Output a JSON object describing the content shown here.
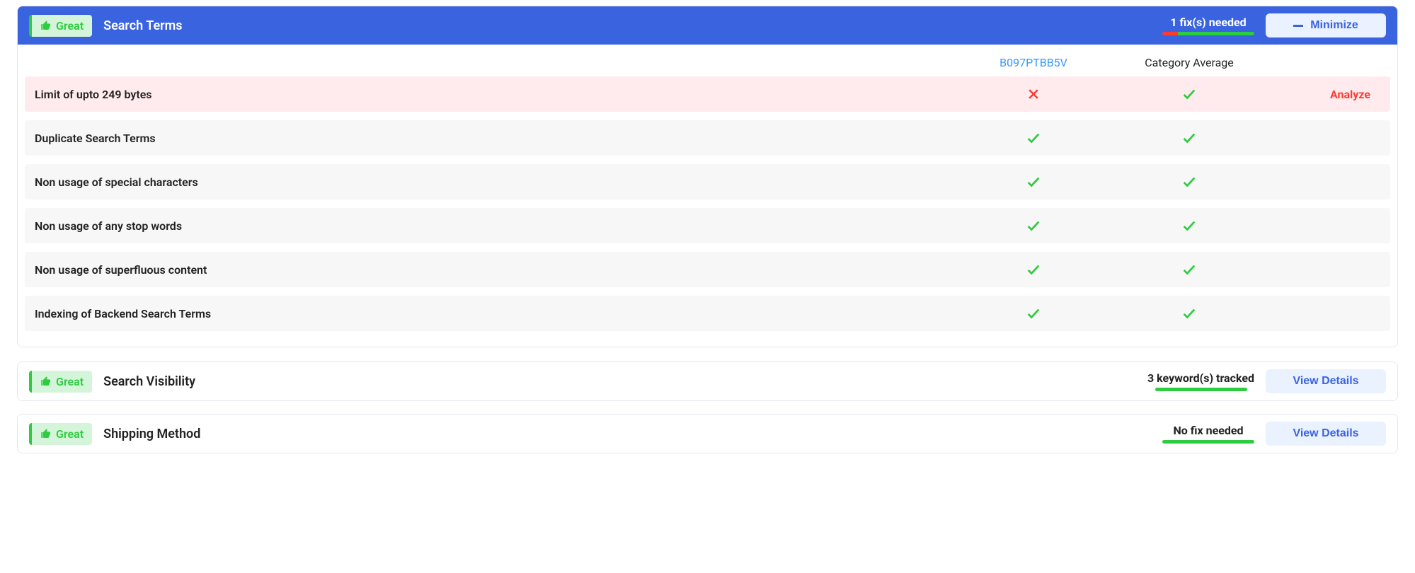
{
  "search_terms_panel": {
    "badge": "Great",
    "title": "Search Terms",
    "fix_status": "1 fix(s) needed",
    "progress": {
      "fail_pct": 17,
      "pass_pct": 83
    },
    "action_label": "Minimize",
    "columns": {
      "product_id": "B097PTBB5V",
      "category_average": "Category Average"
    },
    "analyze_label": "Analyze",
    "rows": [
      {
        "label": "Limit of upto 249 bytes",
        "product_pass": false,
        "category_pass": true,
        "show_analyze": true
      },
      {
        "label": "Duplicate Search Terms",
        "product_pass": true,
        "category_pass": true,
        "show_analyze": false
      },
      {
        "label": "Non usage of special characters",
        "product_pass": true,
        "category_pass": true,
        "show_analyze": false
      },
      {
        "label": "Non usage of any stop words",
        "product_pass": true,
        "category_pass": true,
        "show_analyze": false
      },
      {
        "label": "Non usage of superfluous content",
        "product_pass": true,
        "category_pass": true,
        "show_analyze": false
      },
      {
        "label": "Indexing of Backend Search Terms",
        "product_pass": true,
        "category_pass": true,
        "show_analyze": false
      }
    ]
  },
  "search_visibility_panel": {
    "badge": "Great",
    "title": "Search Visibility",
    "fix_status": "3 keyword(s) tracked",
    "progress": {
      "fail_pct": 0,
      "pass_pct": 100
    },
    "action_label": "View Details"
  },
  "shipping_method_panel": {
    "badge": "Great",
    "title": "Shipping Method",
    "fix_status": "No fix needed",
    "progress": {
      "fail_pct": 0,
      "pass_pct": 100
    },
    "action_label": "View Details"
  }
}
